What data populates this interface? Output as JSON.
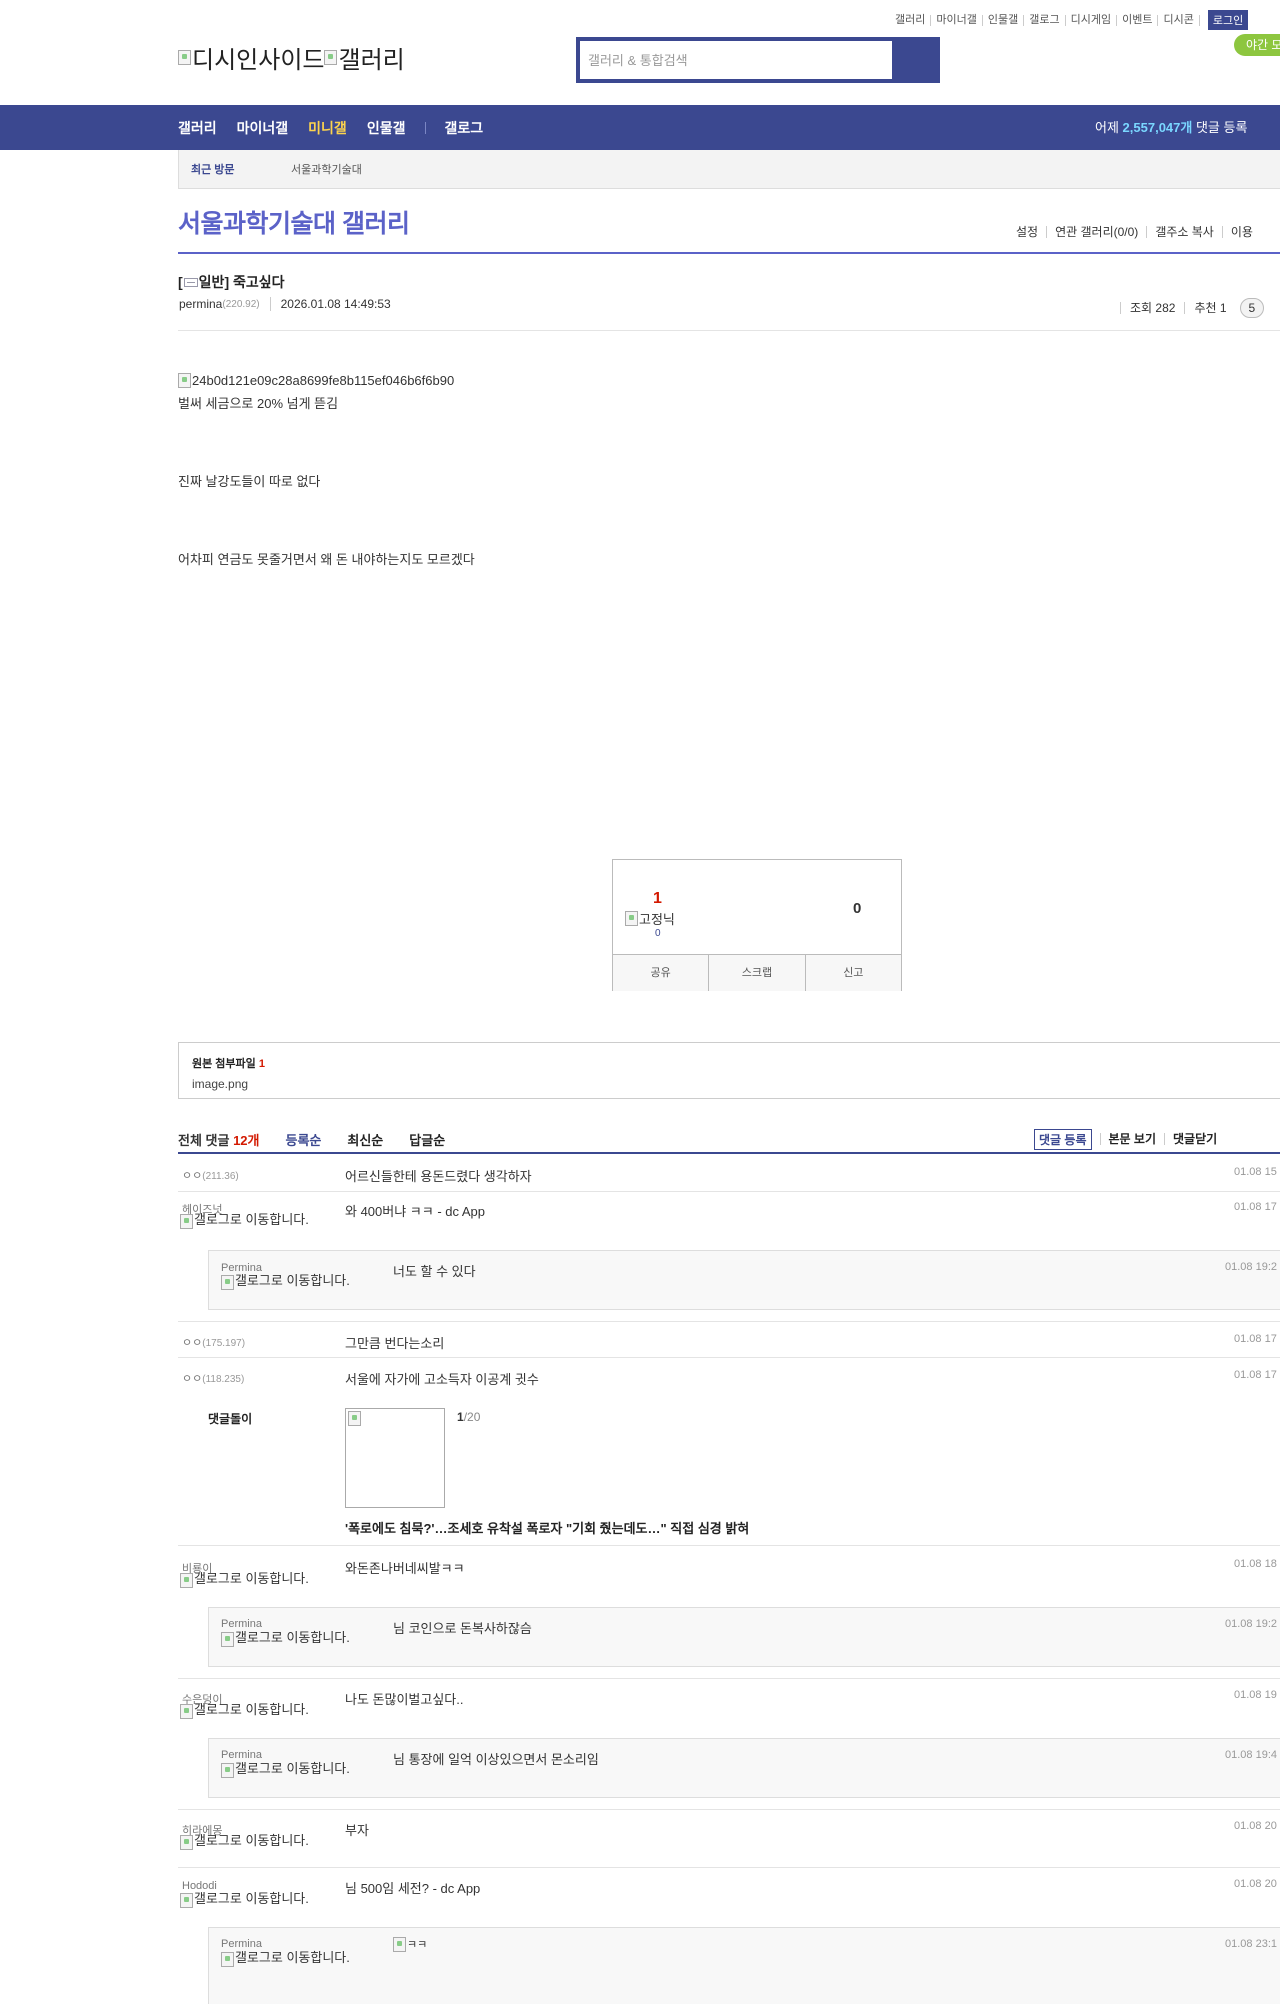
{
  "top_links": [
    "갤러리",
    "마이너갤",
    "인물갤",
    "갤로그",
    "디시게임",
    "이벤트",
    "디시콘"
  ],
  "login_label": "로그인",
  "night_mode_label": "야간 모드",
  "logo": {
    "alt1": "디시인사이드",
    "alt2": "갤러리"
  },
  "search": {
    "placeholder": "갤러리 & 통합검색"
  },
  "gnb": {
    "items": [
      "갤러리",
      "마이너갤",
      "미니갤",
      "인물갤",
      "갤로그"
    ],
    "active_index": 2,
    "stat_prefix": "어제 ",
    "stat_value": "2,557,047개",
    "stat_suffix": " 댓글 등록"
  },
  "recent": {
    "label": "최근 방문",
    "item": "서울과학기술대"
  },
  "gallery": {
    "title": "서울과학기술대 갤러리",
    "tools": [
      "설정",
      "연관 갤러리(0/0)",
      "갤주소 복사",
      "이용"
    ]
  },
  "post": {
    "title_prefix": "[",
    "category": "일반",
    "title_suffix": "] 죽고싶다",
    "author": "permina",
    "ip": "(220.92)",
    "date": "2026.01.08 14:49:53",
    "views": "조회 282",
    "recommend": "추천 1",
    "comment_count": "5",
    "image_alt": "24b0d121e09c28a8699fe8b115ef046b6f6b90",
    "paragraphs": [
      "벌써 세금으로 20% 넘게 뜯김",
      "진짜 날강도들이 따로 없다",
      "어차피 연금도 못줄거면서 왜 돈 내야하는지도 모르겠다"
    ]
  },
  "rec_box": {
    "up_count": "1",
    "fix_nick_alt": "고정닉",
    "fix_count": "0",
    "down_count": "0",
    "buttons": [
      "공유",
      "스크랩",
      "신고"
    ]
  },
  "attachment": {
    "title": "원본 첨부파일 ",
    "count": "1",
    "file": "image.png"
  },
  "comments_header": {
    "total_prefix": "전체 댓글 ",
    "total_count": "12개",
    "sorts": [
      "등록순",
      "최신순",
      "답글순"
    ],
    "register_label": "댓글 등록",
    "view_body": "본문 보기",
    "close_label": "댓글닫기"
  },
  "gallog_alt": "갤로그로 이동합니다.",
  "comments": [
    {
      "nick": "ㅇㅇ",
      "ip": "(211.36)",
      "text": "어르신들한테 용돈드렸다 생각하자",
      "date": "01.08 15"
    },
    {
      "nick": "헤이즈넛",
      "text": "와 400버냐 ㅋㅋ - dc App",
      "date": "01.08 17"
    },
    {
      "nick": "Permina",
      "text": "너도 할 수 있다",
      "date": "01.08 19:2"
    },
    {
      "nick": "ㅇㅇ",
      "ip": "(175.197)",
      "text": "그만큼 번다는소리",
      "date": "01.08 17"
    },
    {
      "nick": "ㅇㅇ",
      "ip": "(118.235)",
      "text": "서울에 자가에 고소득자 이공계 귓수",
      "date": "01.08 17"
    },
    {
      "nick": "비룡이",
      "text": "와돈존나버네씨발ㅋㅋ",
      "date": "01.08 18"
    },
    {
      "nick": "Permina",
      "text": "님 코인으로 돈복사하잖슴",
      "date": "01.08 19:2"
    },
    {
      "nick": "수은덩이",
      "text": "나도 돈많이벌고싶다..",
      "date": "01.08 19"
    },
    {
      "nick": "Permina",
      "text": "님 통장에 일억 이상있으면서 몬소리임",
      "date": "01.08 19:4"
    },
    {
      "nick": "히라에몽",
      "text": "부자",
      "date": "01.08 20"
    },
    {
      "nick": "Hododi",
      "text": "님 500임 세전? - dc App",
      "date": "01.08 20"
    },
    {
      "nick": "Permina",
      "text": "ㅋㅋ",
      "date": "01.08 23:1"
    }
  ],
  "ad_block": {
    "label": "댓글돌이",
    "page_current": "1",
    "page_total": "/20",
    "headline": "'폭로에도 침묵?'…조세호 유착설 폭로자 \"기회 줬는데도…\" 직접 심경 밝혀"
  }
}
